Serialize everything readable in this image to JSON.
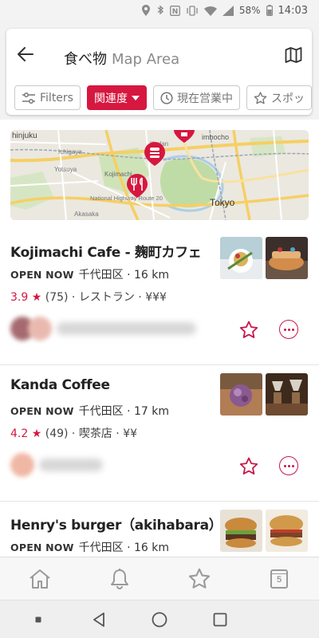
{
  "status_bar": {
    "battery": "58%",
    "time": "14:03",
    "icons": [
      "location-icon",
      "bluetooth-icon",
      "nfc-icon",
      "vibrate-icon",
      "wifi-icon",
      "signal-icon",
      "battery-icon"
    ]
  },
  "search": {
    "query": "食べ物",
    "area": "Map Area"
  },
  "filters": {
    "filters_label": "Filters",
    "sort_label": "関連度",
    "open_now_label": "現在営業中",
    "spot_label": "スポッ"
  },
  "map": {
    "labels": {
      "shinjuku": "hinjuku",
      "tokyo": "Tokyo",
      "jimbocho": "imbocho",
      "kojimachi": "Kojimachi",
      "yotsuya": "Yotsuya",
      "kudan": "Kudan",
      "akasaka": "Akasaka",
      "route": "National Highway Route 20",
      "ichigaya": "Ichigaya"
    }
  },
  "results": [
    {
      "name": "Kojimachi Cafe - 麹町カフェ",
      "status": "OPEN NOW",
      "area": "千代田区",
      "distance": "16 km",
      "rating": "3.9",
      "reviews": "(75)",
      "category": "レストラン",
      "price": "¥¥¥"
    },
    {
      "name": "Kanda Coffee",
      "status": "OPEN NOW",
      "area": "千代田区",
      "distance": "17 km",
      "rating": "4.2",
      "reviews": "(49)",
      "category": "喫茶店",
      "price": "¥¥"
    },
    {
      "name": "Henry's burger（akihabara）",
      "status": "OPEN NOW",
      "area": "千代田区",
      "distance": "16 km"
    }
  ],
  "bottom_nav": {
    "calendar_number": "5"
  },
  "colors": {
    "accent": "#d6173f",
    "chip_border": "#c9c9c9"
  }
}
